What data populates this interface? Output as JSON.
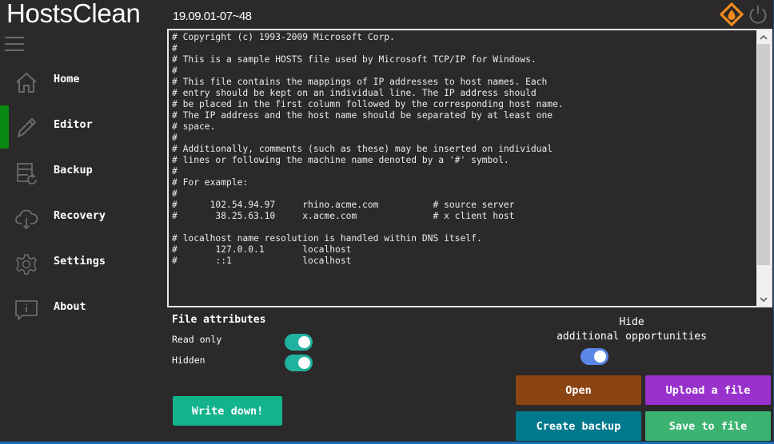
{
  "app": {
    "title": "HostsClean",
    "version": "19.09.01-07~48"
  },
  "header": {
    "logo_icon": "flame-diamond-icon",
    "power_icon": "power-icon",
    "menu_icon": "hamburger-menu-icon"
  },
  "sidebar": {
    "items": [
      {
        "label": "Home",
        "icon": "home-icon",
        "active": false
      },
      {
        "label": "Editor",
        "icon": "pencil-icon",
        "active": true
      },
      {
        "label": "Backup",
        "icon": "backup-icon",
        "active": false
      },
      {
        "label": "Recovery",
        "icon": "cloud-download-icon",
        "active": false
      },
      {
        "label": "Settings",
        "icon": "gear-icon",
        "active": false
      },
      {
        "label": "About",
        "icon": "info-icon",
        "active": false
      }
    ]
  },
  "editor": {
    "content": "# Copyright (c) 1993-2009 Microsoft Corp.\n#\n# This is a sample HOSTS file used by Microsoft TCP/IP for Windows.\n#\n# This file contains the mappings of IP addresses to host names. Each\n# entry should be kept on an individual line. The IP address should\n# be placed in the first column followed by the corresponding host name.\n# The IP address and the host name should be separated by at least one\n# space.\n#\n# Additionally, comments (such as these) may be inserted on individual\n# lines or following the machine name denoted by a '#' symbol.\n#\n# For example:\n#\n#      102.54.94.97     rhino.acme.com          # source server\n#       38.25.63.10     x.acme.com              # x client host\n\n# localhost name resolution is handled within DNS itself.\n#\t127.0.0.1       localhost\n#\t::1             localhost"
  },
  "file_attributes": {
    "title": "File attributes",
    "read_only": {
      "label": "Read only",
      "on": true
    },
    "hidden": {
      "label": "Hidden",
      "on": true
    }
  },
  "hide_additional": {
    "label_line1": "Hide",
    "label_line2": "additional opportunities",
    "on": true
  },
  "buttons": {
    "write_down": {
      "label": "Write down!",
      "color": "#13b38c"
    },
    "open": {
      "label": "Open",
      "color": "#8b4513"
    },
    "upload": {
      "label": "Upload a file",
      "color": "#9932cc"
    },
    "create_backup": {
      "label": "Create backup",
      "color": "#00798c"
    },
    "save_to_file": {
      "label": "Save to file",
      "color": "#3cb371"
    }
  },
  "colors": {
    "background": "#2b2929",
    "active_indicator": "#0a8a12",
    "toggle_teal": "#20b2a0",
    "toggle_blue": "#5b87e6",
    "accent_orange": "#f08a1c"
  }
}
